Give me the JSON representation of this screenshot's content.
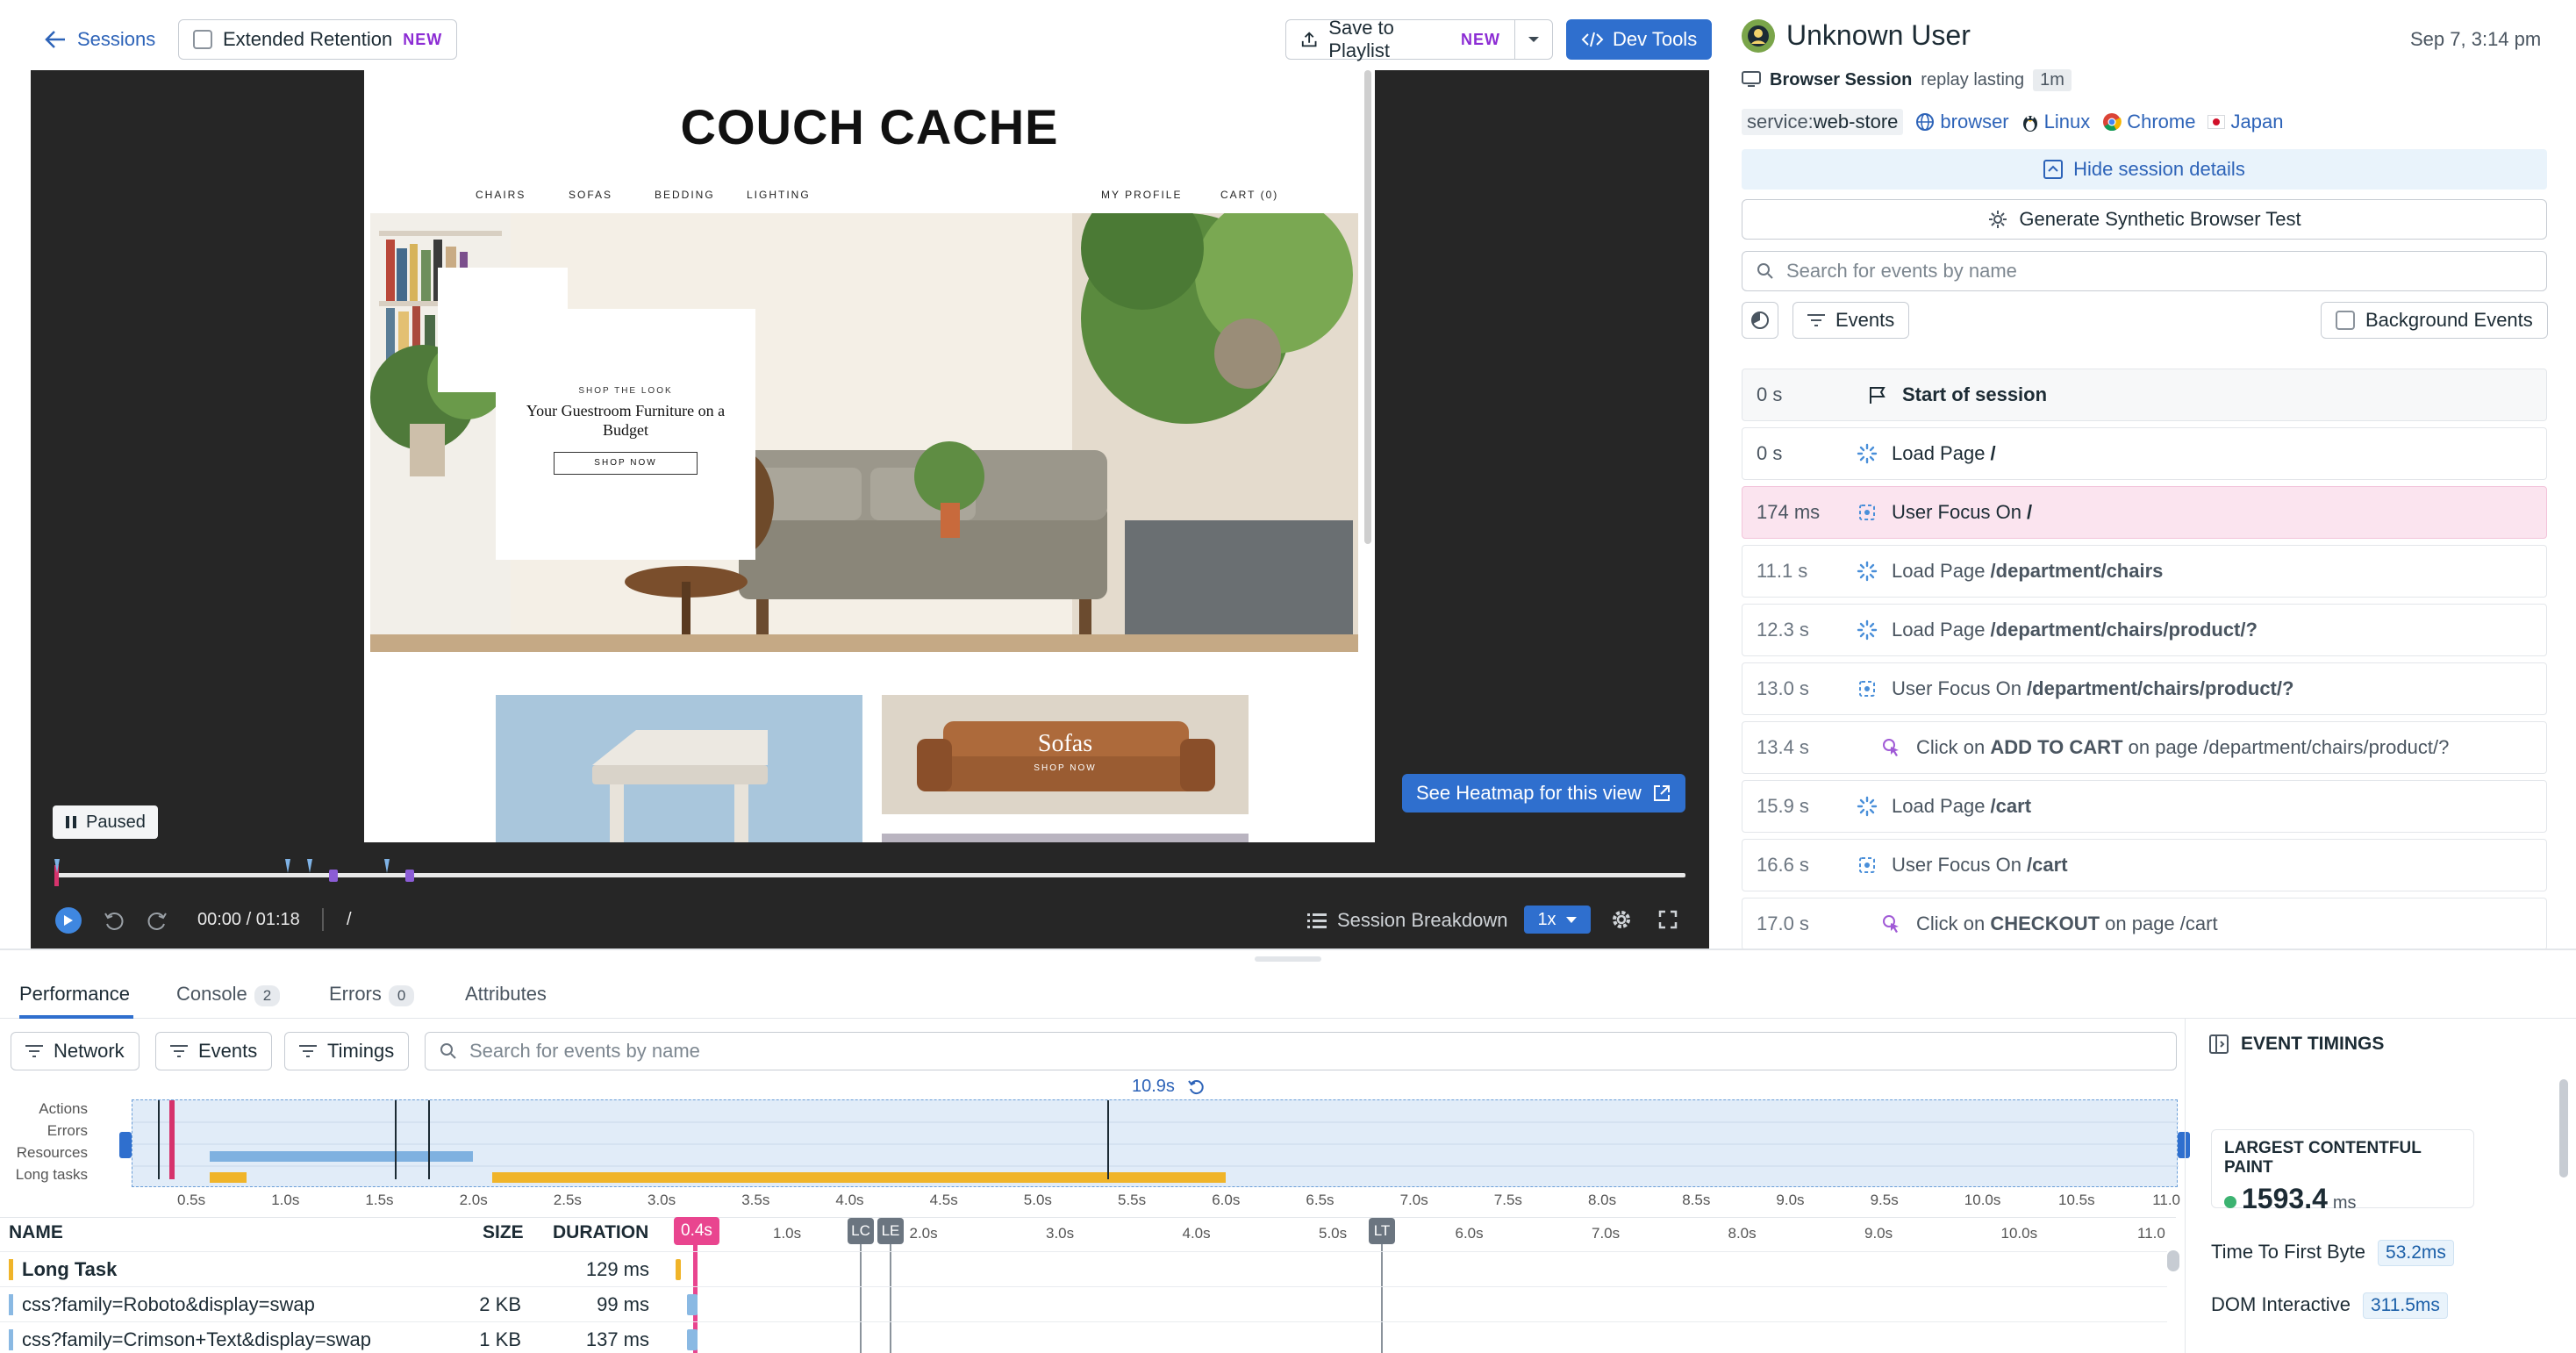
{
  "toolbar": {
    "back_label": "Sessions",
    "retention_label": "Extended Retention",
    "retention_badge": "NEW",
    "playlist_label": "Save to Playlist",
    "playlist_badge": "NEW",
    "devtools_label": "Dev Tools"
  },
  "site": {
    "title": "COUCH CACHE",
    "nav_left": [
      "CHAIRS",
      "SOFAS",
      "BEDDING",
      "LIGHTING"
    ],
    "nav_right": [
      "MY PROFILE",
      "CART (0)"
    ],
    "promo_kicker": "SHOP THE LOOK",
    "promo_title": "Your Guestroom Furniture on a Budget",
    "promo_button": "SHOP NOW",
    "sofas_title": "Sofas",
    "sofas_button": "SHOP NOW"
  },
  "player": {
    "paused_label": "Paused",
    "heatmap_label": "See Heatmap for this view",
    "time": "00:00 / 01:18",
    "path": "/",
    "breakdown_label": "Session Breakdown",
    "speed": "1x"
  },
  "session": {
    "user": "Unknown User",
    "date": "Sep 7, 3:14 pm",
    "type_label": "Browser Session",
    "replay_text": "replay lasting",
    "duration": "1m",
    "tag_service_key": "service:",
    "tag_service_val": "web-store",
    "tag_browser": "browser",
    "tag_os": "Linux",
    "tag_client": "Chrome",
    "tag_country": "Japan",
    "hide_details": "Hide session details",
    "synthetic": "Generate Synthetic Browser Test",
    "search_placeholder": "Search for events by name",
    "events_filter": "Events",
    "background_events": "Background Events"
  },
  "events": [
    {
      "time": "0 s",
      "pre": "",
      "bold": "Start of session",
      "post": "",
      "kind": "flag"
    },
    {
      "time": "0 s",
      "pre": "Load Page ",
      "bold": "/",
      "post": "",
      "kind": "load"
    },
    {
      "time": "174 ms",
      "pre": "User Focus On ",
      "bold": "/",
      "post": "",
      "kind": "focus"
    },
    {
      "time": "11.1 s",
      "pre": "Load Page ",
      "bold": "/department/chairs",
      "post": "",
      "kind": "load"
    },
    {
      "time": "12.3 s",
      "pre": "Load Page ",
      "bold": "/department/chairs/product/?",
      "post": "",
      "kind": "load"
    },
    {
      "time": "13.0 s",
      "pre": "User Focus On ",
      "bold": "/department/chairs/product/?",
      "post": "",
      "kind": "focus"
    },
    {
      "time": "13.4 s",
      "pre": "Click on ",
      "bold": "ADD TO CART",
      "post": " on page /department/chairs/product/?",
      "kind": "click"
    },
    {
      "time": "15.9 s",
      "pre": "Load Page ",
      "bold": "/cart",
      "post": "",
      "kind": "load"
    },
    {
      "time": "16.6 s",
      "pre": "User Focus On ",
      "bold": "/cart",
      "post": "",
      "kind": "focus"
    },
    {
      "time": "17.0 s",
      "pre": "Click on ",
      "bold": "CHECKOUT",
      "post": " on page /cart",
      "kind": "click"
    }
  ],
  "perf": {
    "tabs": [
      {
        "label": "Performance",
        "count": ""
      },
      {
        "label": "Console",
        "count": "2"
      },
      {
        "label": "Errors",
        "count": "0"
      },
      {
        "label": "Attributes",
        "count": ""
      }
    ],
    "filter_network": "Network",
    "filter_events": "Events",
    "filter_timings": "Timings",
    "search_placeholder": "Search for events by name",
    "range_label": "10.9s",
    "lane_labels": [
      "Actions",
      "Errors",
      "Resources",
      "Long tasks"
    ],
    "axis_ticks": [
      "0.5s",
      "1.0s",
      "1.5s",
      "2.0s",
      "2.5s",
      "3.0s",
      "3.5s",
      "4.0s",
      "4.5s",
      "5.0s",
      "5.5s",
      "6.0s",
      "6.5s",
      "7.0s",
      "7.5s",
      "8.0s",
      "8.5s",
      "9.0s",
      "9.5s",
      "10.0s",
      "10.5s",
      "11.0"
    ],
    "columns": {
      "name": "NAME",
      "size": "SIZE",
      "duration": "DURATION"
    },
    "marker_current": "0.4s",
    "markers": [
      "LC",
      "LE",
      "LT"
    ],
    "wf_ticks": [
      "1.0s",
      "2.0s",
      "3.0s",
      "4.0s",
      "5.0s",
      "6.0s",
      "7.0s",
      "8.0s",
      "9.0s",
      "10.0s",
      "11.0"
    ],
    "rows": [
      {
        "name": "Long Task",
        "size": "",
        "duration": "129 ms",
        "color": "#f0b429"
      },
      {
        "name": "css?family=Roboto&display=swap",
        "size": "2 KB",
        "duration": "99 ms",
        "color": "#8ab9e3"
      },
      {
        "name": "css?family=Crimson+Text&display=swap",
        "size": "1 KB",
        "duration": "137 ms",
        "color": "#8ab9e3"
      }
    ]
  },
  "timings": {
    "header": "EVENT TIMINGS",
    "lcp_label": "LARGEST CONTENTFUL PAINT",
    "lcp_value": "1593.4",
    "lcp_unit": "ms",
    "ttfb_label": "Time To First Byte",
    "ttfb_value": "53.2ms",
    "dom_label": "DOM Interactive",
    "dom_value": "311.5ms"
  }
}
